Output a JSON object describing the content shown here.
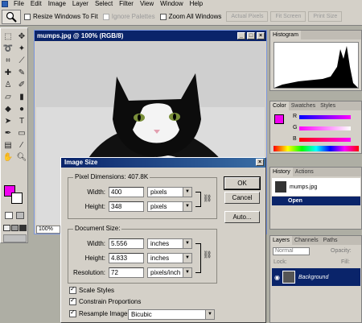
{
  "menubar": {
    "items": [
      "File",
      "Edit",
      "Image",
      "Layer",
      "Select",
      "Filter",
      "View",
      "Window",
      "Help"
    ]
  },
  "options": {
    "resize_windows": "Resize Windows To Fit",
    "ignore_palettes": "Ignore Palettes",
    "zoom_all": "Zoom All Windows",
    "actual_pixels": "Actual Pixels",
    "fit_screen": "Fit Screen",
    "print_size": "Print Size"
  },
  "document": {
    "title": "mumps.jpg @ 100% (RGB/8)",
    "zoom": "100%"
  },
  "panels": {
    "histogram_title": "Histogram",
    "color_tab": "Color",
    "swatches_tab": "Swatches",
    "styles_tab": "Styles",
    "channel_r": "R",
    "channel_g": "G",
    "channel_b": "B",
    "history_tab": "History",
    "actions_tab": "Actions",
    "history_file": "mumps.jpg",
    "history_step": "Open",
    "layers_tab": "Layers",
    "channels_tab": "Channels",
    "paths_tab": "Paths",
    "blend_mode": "Normal",
    "opacity_label": "Opacity:",
    "lock_label": "Lock:",
    "fill_label": "Fill:",
    "layer_name": "Background",
    "colors": {
      "foreground": "#f000f0",
      "background": "#ffffff",
      "titlebar": "#0a246a"
    }
  },
  "dialog": {
    "title": "Image Size",
    "pixel_dimensions_label": "Pixel Dimensions:",
    "pixel_dimensions_value": "407.8K",
    "width_label": "Width:",
    "width_px": "400",
    "height_label": "Height:",
    "height_px": "348",
    "pixel_unit": "pixels",
    "document_size_label": "Document Size:",
    "width_doc": "5.556",
    "height_doc": "4.833",
    "doc_unit": "inches",
    "resolution_label": "Resolution:",
    "resolution": "72",
    "resolution_unit": "pixels/inch",
    "scale_styles": "Scale Styles",
    "constrain_proportions": "Constrain Proportions",
    "resample_label": "Resample Image:",
    "resample_method": "Bicubic",
    "ok": "OK",
    "cancel": "Cancel",
    "auto": "Auto..."
  }
}
